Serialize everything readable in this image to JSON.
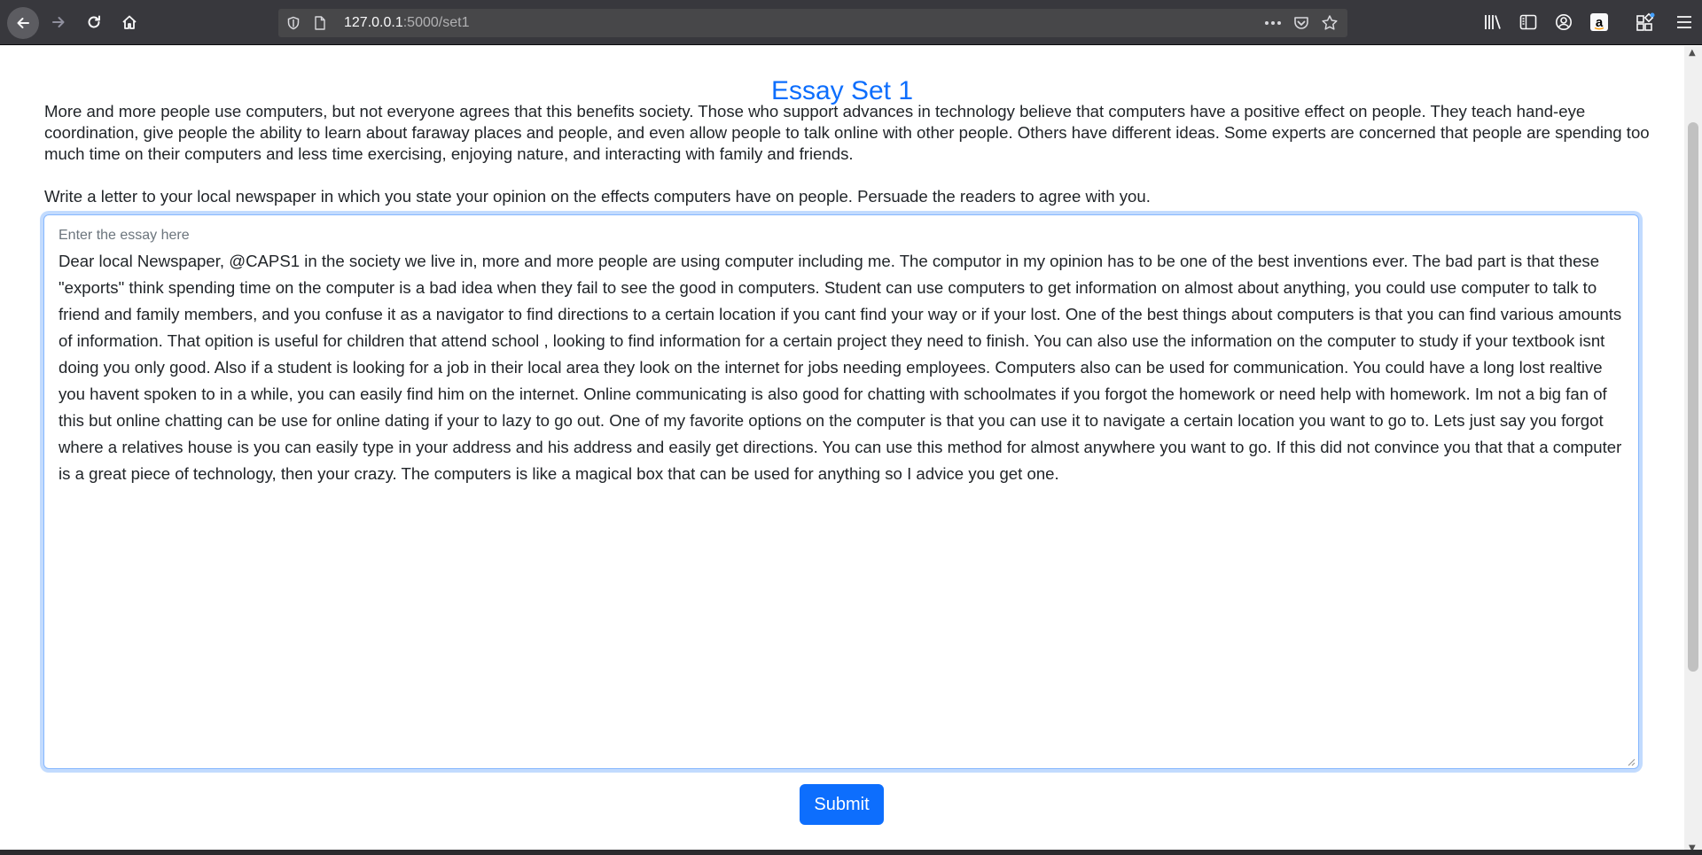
{
  "browser": {
    "url_host": "127.0.0.1",
    "url_path": ":5000/set1",
    "icons": {
      "back": "back-arrow-icon",
      "forward": "forward-arrow-icon",
      "reload": "reload-icon",
      "home": "home-icon",
      "shield": "shield-icon",
      "page": "page-icon",
      "more": "more-dots-icon",
      "pocket": "pocket-icon",
      "bookmark": "star-icon",
      "library": "library-icon",
      "sidebar": "sidebar-icon",
      "account": "account-icon",
      "amazon": "amazon-icon",
      "extensions": "extensions-icon",
      "menu": "hamburger-menu-icon"
    },
    "colors": {
      "toolbar": "#38383d",
      "urlbar": "#474749"
    }
  },
  "page": {
    "title": "Essay Set 1",
    "prompt_paragraph": "More and more people use computers, but not everyone agrees that this benefits society. Those who support advances in technology believe that computers have a positive effect on people. They teach hand-eye coordination, give people the ability to learn about faraway places and people, and even allow people to talk online with other people. Others have different ideas. Some experts are concerned that people are spending too much time on their computers and less time exercising, enjoying nature, and interacting with family and friends.",
    "instruction": "Write a letter to your local newspaper in which you state your opinion on the effects computers have on people. Persuade the readers to agree with you.",
    "essay": {
      "placeholder": "Enter the essay here",
      "value": "Dear local Newspaper, @CAPS1 in the society we live in, more and more people are using computer including me. The computor in my opinion has to be one of the best inventions ever. The bad part is that these \"exports\" think spending time on the computer is a bad idea when they fail to see the good in computers. Student can use computers to get information on almost about anything, you could use computer to talk to friend and family members, and you confuse it as a navigator to find directions to a certain location if you cant find your way or if your lost. One of the best things about computers is that you can find various amounts of information. That opition is useful for children that attend school , looking to find information for a certain project they need to finish. You can also use the information on the computer to study if your textbook isnt doing you only good. Also if a student is looking for a job in their local area they look on the internet for jobs needing employees. Computers also can be used for communication. You could have a long lost realtive you havent spoken to in a while, you can easily find him on the internet. Online communicating is also good for chatting with schoolmates if you forgot the homework or need help with homework. Im not a big fan of this but online chatting can be use for online dating if your to lazy to go out. One of my favorite options on the computer is that you can use it to navigate a certain location you want to go to. Lets just say you forgot where a relatives house is you can easily type in your address and his address and easily get directions. You can use this method for almost anywhere you want to go. If this did not convince you that that a computer is a great piece of technology, then your crazy. The computers is like a magical box that can be used for anything so I advice you get one."
    },
    "submit_label": "Submit",
    "colors": {
      "accent": "#0d6efd",
      "text": "#212529",
      "placeholder": "#6c757d"
    }
  }
}
